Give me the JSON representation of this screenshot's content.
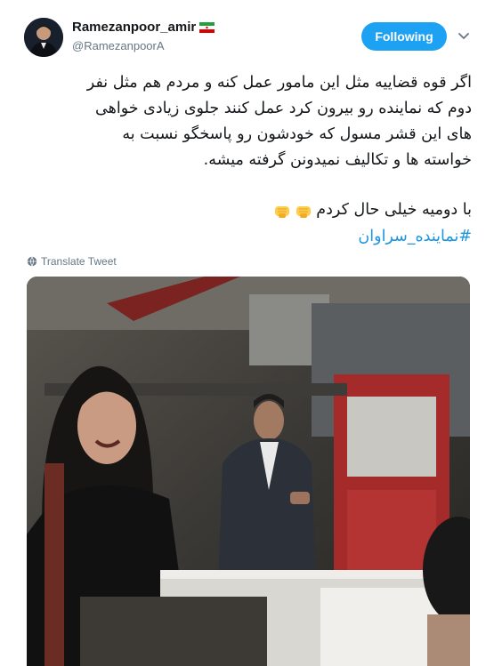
{
  "author": {
    "display_name": "Ramezanpoor_amir",
    "handle": "@RamezanpoorA",
    "flag_icon": "iran-flag-icon"
  },
  "follow_button": {
    "label": "Following",
    "color": "#1da1f2"
  },
  "menu_icon": "chevron-down-icon",
  "tweet": {
    "lines": [
      "اگر قوه قضاییه مثل این مامور عمل کنه و مردم هم مثل نفر",
      "دوم که نماینده رو بیرون کرد عمل کنند جلوی زیادی خواهی",
      "های این قشر مسول که خودشون رو پاسخگو نسبت به",
      "خواسته ها و تکالیف نمیدونن گرفته میشه."
    ],
    "second_line": "با دومیه خیلی حال کردم",
    "emoji_icons": [
      "fist-emoji",
      "fist-emoji"
    ],
    "hashtag": "#نماینده_سراوان"
  },
  "translate": {
    "label": "Translate Tweet",
    "icon": "globe-icon"
  },
  "media": {
    "type": "video-still",
    "description_icon": "video-thumbnail"
  },
  "colors": {
    "text": "#14171a",
    "secondary": "#657786",
    "link": "#1b95e0"
  }
}
